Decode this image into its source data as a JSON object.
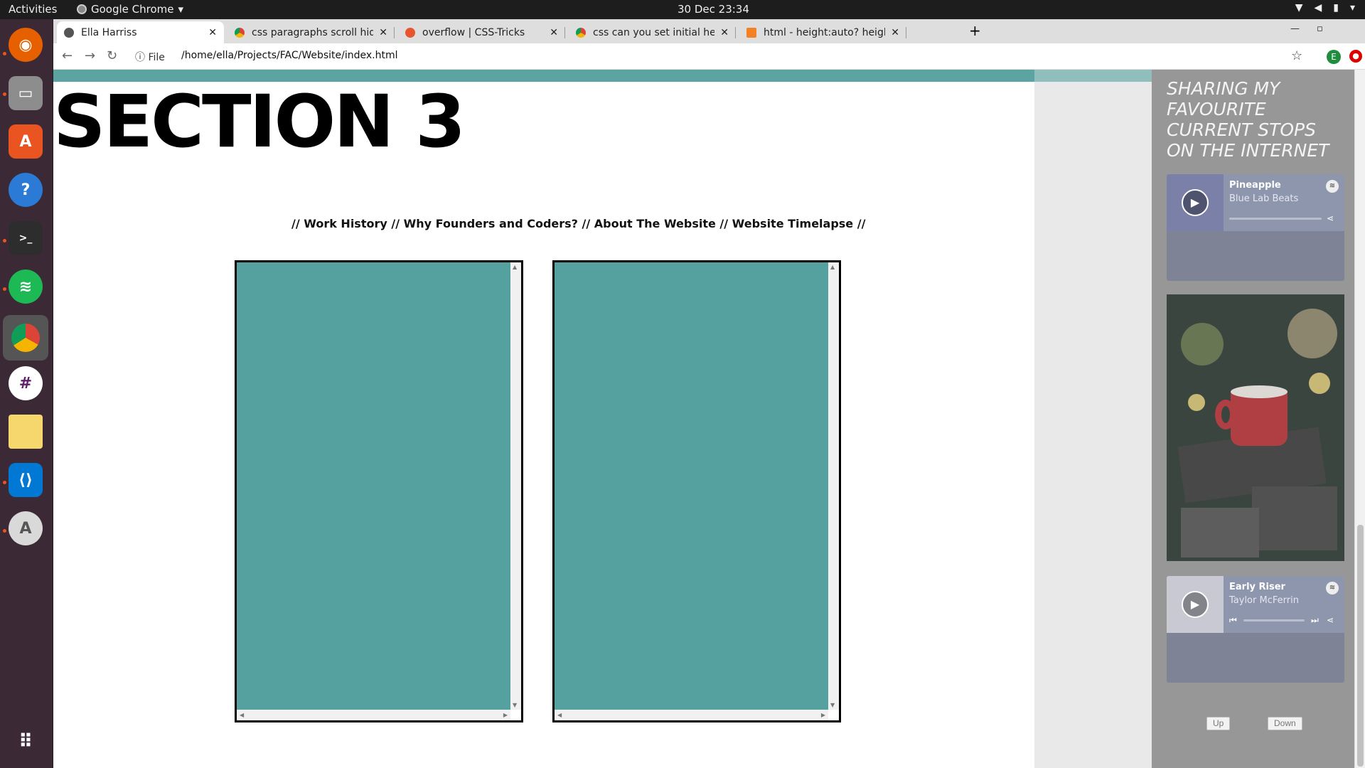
{
  "system": {
    "activities": "Activities",
    "app_name": "Google Chrome",
    "clock": "30 Dec  23:34"
  },
  "browser": {
    "tabs": [
      {
        "title": "Ella Harriss"
      },
      {
        "title": "css paragraphs scroll hidd"
      },
      {
        "title": "overflow | CSS-Tricks"
      },
      {
        "title": "css can you set initial heig"
      },
      {
        "title": "html - height:auto? height"
      }
    ],
    "url_scheme": "File",
    "url": "/home/ella/Projects/FAC/Website/index.html",
    "profile_initial": "E"
  },
  "page": {
    "heading": "SECTION 3",
    "section_nav": "// Work History // Why Founders and Coders? // About The Website // Website Timelapse //",
    "sidebar": {
      "heading": "SHARING MY FAVOURITE CURRENT STOPS ON THE INTERNET",
      "players": [
        {
          "track": "Pineapple",
          "artist": "Blue Lab Beats"
        },
        {
          "track": "Early Riser",
          "artist": "Taylor McFerrin"
        }
      ],
      "up_label": "Up",
      "down_label": "Down"
    }
  },
  "colors": {
    "teal": "#54a19f",
    "sidebar_bg": "#979797",
    "player_bg": "#8e96ad",
    "ubuntu_orange": "#e95420"
  },
  "icons": [
    "firefox-icon",
    "files-icon",
    "software-icon",
    "help-icon",
    "terminal-icon",
    "spotify-icon",
    "chrome-icon",
    "slack-icon",
    "notes-icon",
    "vscode-icon",
    "updater-icon",
    "app-grid-icon"
  ]
}
